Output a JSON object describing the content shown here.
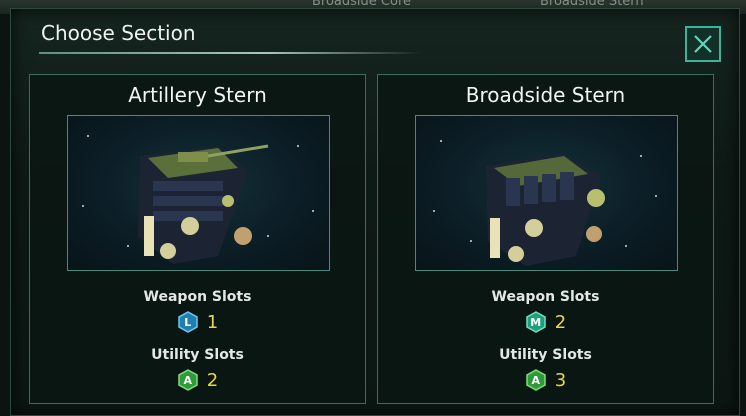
{
  "background": {
    "tabs": [
      "Broadside Core",
      "Broadside Stern"
    ]
  },
  "dialog": {
    "title": "Choose Section",
    "close_icon": "close-x-icon"
  },
  "sections": [
    {
      "name": "Artillery Stern",
      "weapon_slots_label": "Weapon Slots",
      "weapon_slot_type": "L",
      "weapon_slot_count": "1",
      "utility_slots_label": "Utility Slots",
      "utility_slot_type": "A",
      "utility_slot_count": "2"
    },
    {
      "name": "Broadside Stern",
      "weapon_slots_label": "Weapon Slots",
      "weapon_slot_type": "M",
      "weapon_slot_count": "2",
      "utility_slots_label": "Utility Slots",
      "utility_slot_type": "A",
      "utility_slot_count": "3"
    }
  ],
  "colors": {
    "accent": "#3fb39a",
    "large_slot": "#1f7fb0",
    "medium_slot": "#1ea07a",
    "utility_slot": "#2e9a3a",
    "value": "#e6d84a"
  }
}
